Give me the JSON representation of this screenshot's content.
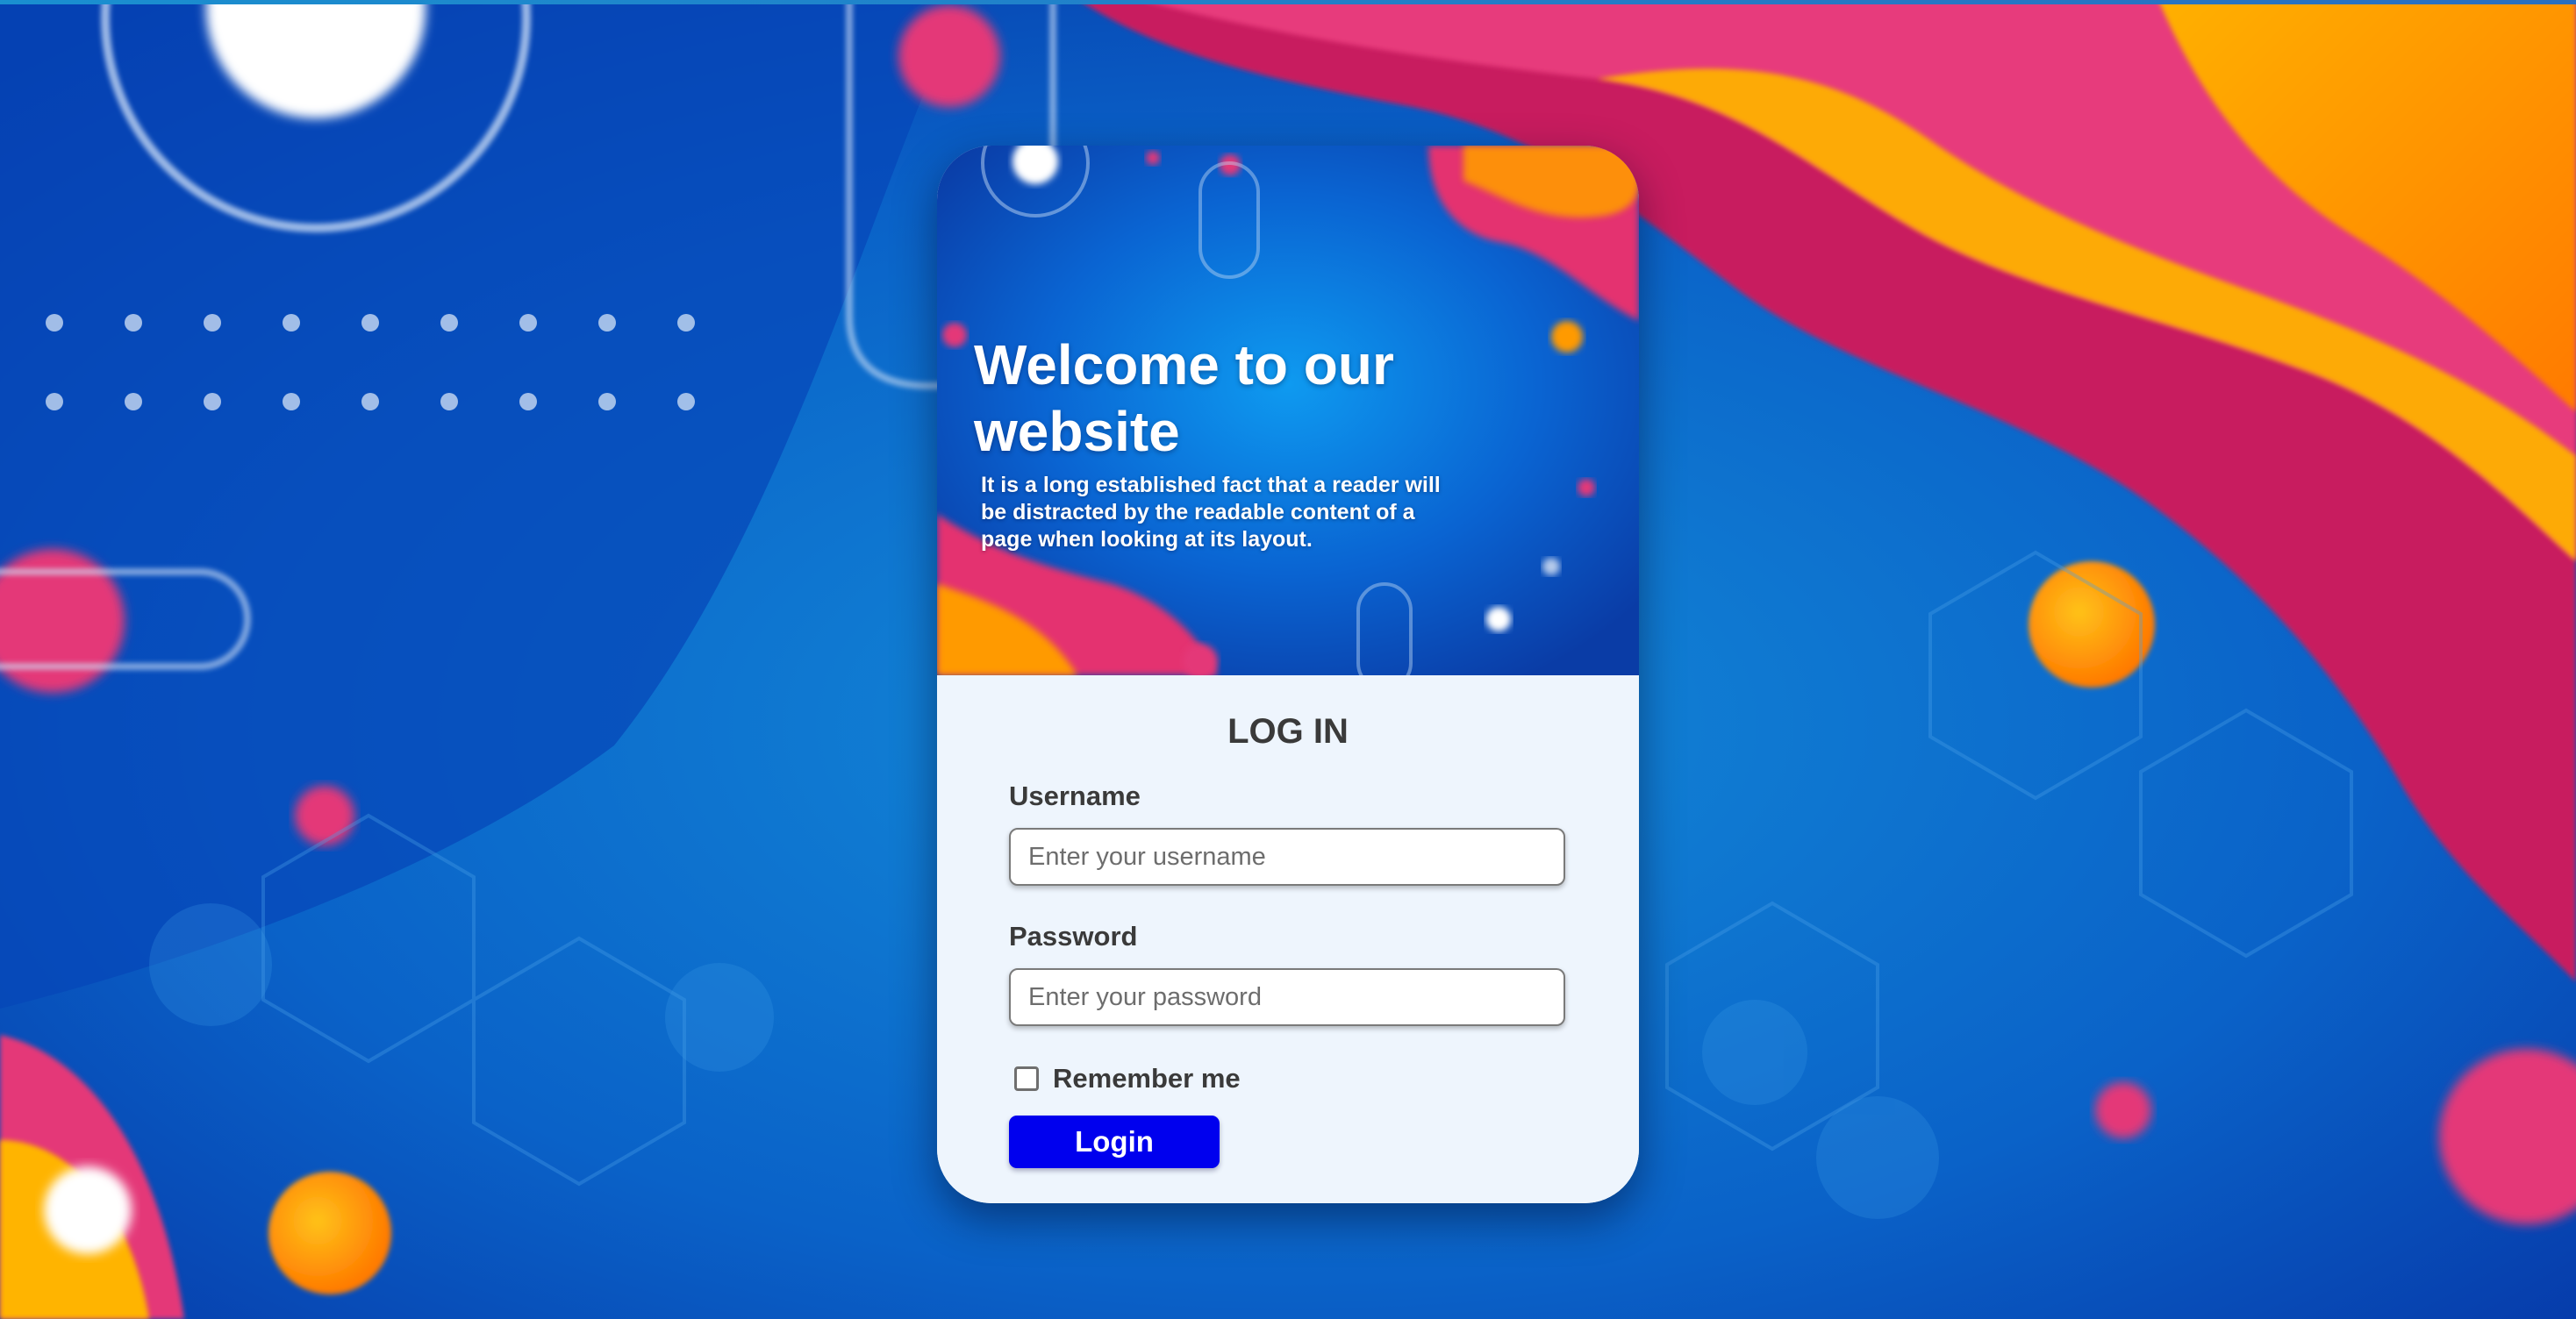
{
  "hero": {
    "title": "Welcome to our website",
    "text": "It is a long established fact that a reader will be distracted by the readable content of a page when looking at its layout."
  },
  "login": {
    "title": "LOG IN",
    "username_label": "Username",
    "username_placeholder": "Enter your username",
    "username_value": "",
    "password_label": "Password",
    "password_placeholder": "Enter your password",
    "password_value": "",
    "remember_label": "Remember me",
    "remember_checked": false,
    "button_label": "Login"
  },
  "colors": {
    "button": "#0000ee",
    "card_background": "#eef5fd",
    "text_dark": "#3a3a3a",
    "background_blue": "#0a5fc4",
    "background_pink": "#e4306f",
    "background_orange": "#ff8a00"
  }
}
